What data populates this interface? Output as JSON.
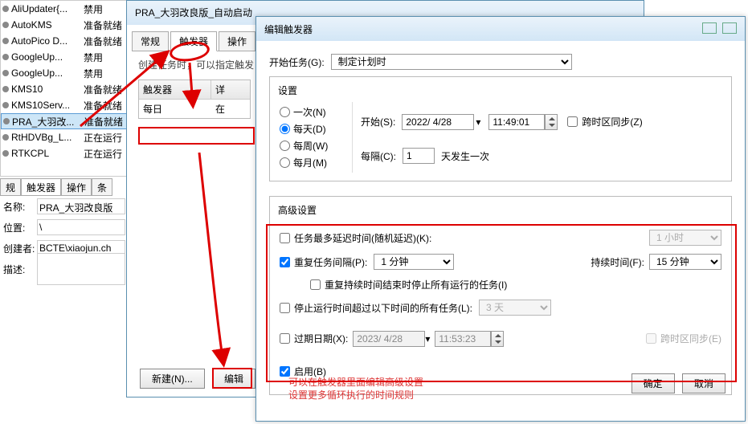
{
  "task_list": [
    {
      "name": "AliUpdater{...",
      "status": "禁用"
    },
    {
      "name": "AutoKMS",
      "status": "准备就绪"
    },
    {
      "name": "AutoPico D...",
      "status": "准备就绪"
    },
    {
      "name": "GoogleUp...",
      "status": "禁用"
    },
    {
      "name": "GoogleUp...",
      "status": "禁用"
    },
    {
      "name": "KMS10",
      "status": "准备就绪"
    },
    {
      "name": "KMS10Serv...",
      "status": "准备就绪"
    },
    {
      "name": "PRA_大羽改...",
      "status": "准备就绪",
      "selected": true
    },
    {
      "name": "RtHDVBg_L...",
      "status": "正在运行"
    },
    {
      "name": "RTKCPL",
      "status": "正在运行"
    }
  ],
  "prop_tabs": {
    "t1": "规",
    "t2": "触发器",
    "t3": "操作",
    "t4": "条"
  },
  "props": {
    "name_label": "名称:",
    "name_val": "PRA_大羽改良版",
    "loc_label": "位置:",
    "loc_val": "\\",
    "author_label": "创建者:",
    "author_val": "BCTE\\xiaojun.ch",
    "desc_label": "描述:"
  },
  "win_mid": {
    "title": "PRA_大羽改良版_自动启动",
    "tabs": {
      "general": "常规",
      "triggers": "触发器",
      "actions": "操作"
    },
    "hint": "创建任务时，可以指定触发",
    "trgcol1": "触发器",
    "trgcol2": "详",
    "trgrow": "每日",
    "trgrow2": "在",
    "btn_new": "新建(N)...",
    "btn_edit": "编辑"
  },
  "win_right": {
    "title": "编辑触发器",
    "begin_label": "开始任务(G):",
    "begin_val": "制定计划时",
    "settings_label": "设置",
    "once": "一次(N)",
    "daily": "每天(D)",
    "weekly": "每周(W)",
    "monthly": "每月(M)",
    "start_label": "开始(S):",
    "start_date": "2022/ 4/28",
    "start_time": "11:49:01",
    "tzsync": "跨时区同步(Z)",
    "every_label": "每隔(C):",
    "every_val": "1",
    "every_unit": "天发生一次",
    "adv_label": "高级设置",
    "delay": "任务最多延迟时间(随机延迟)(K):",
    "delay_val": "1 小时",
    "repeat": "重复任务间隔(P):",
    "repeat_val": "1 分钟",
    "dur_label": "持续时间(F):",
    "dur_val": "15 分钟",
    "stop_repeat": "重复持续时间结束时停止所有运行的任务(I)",
    "stop_after": "停止运行时间超过以下时间的所有任务(L):",
    "stop_val": "3 天",
    "expire": "过期日期(X):",
    "exp_date": "2023/ 4/28",
    "exp_time": "11:53:23",
    "exp_tz": "跨时区同步(E)",
    "enable": "启用(B)",
    "ok": "确定",
    "cancel": "取消",
    "note1": "可以在触发器里面编辑高级设置",
    "note2": "设置更多循环执行的时间规则"
  }
}
